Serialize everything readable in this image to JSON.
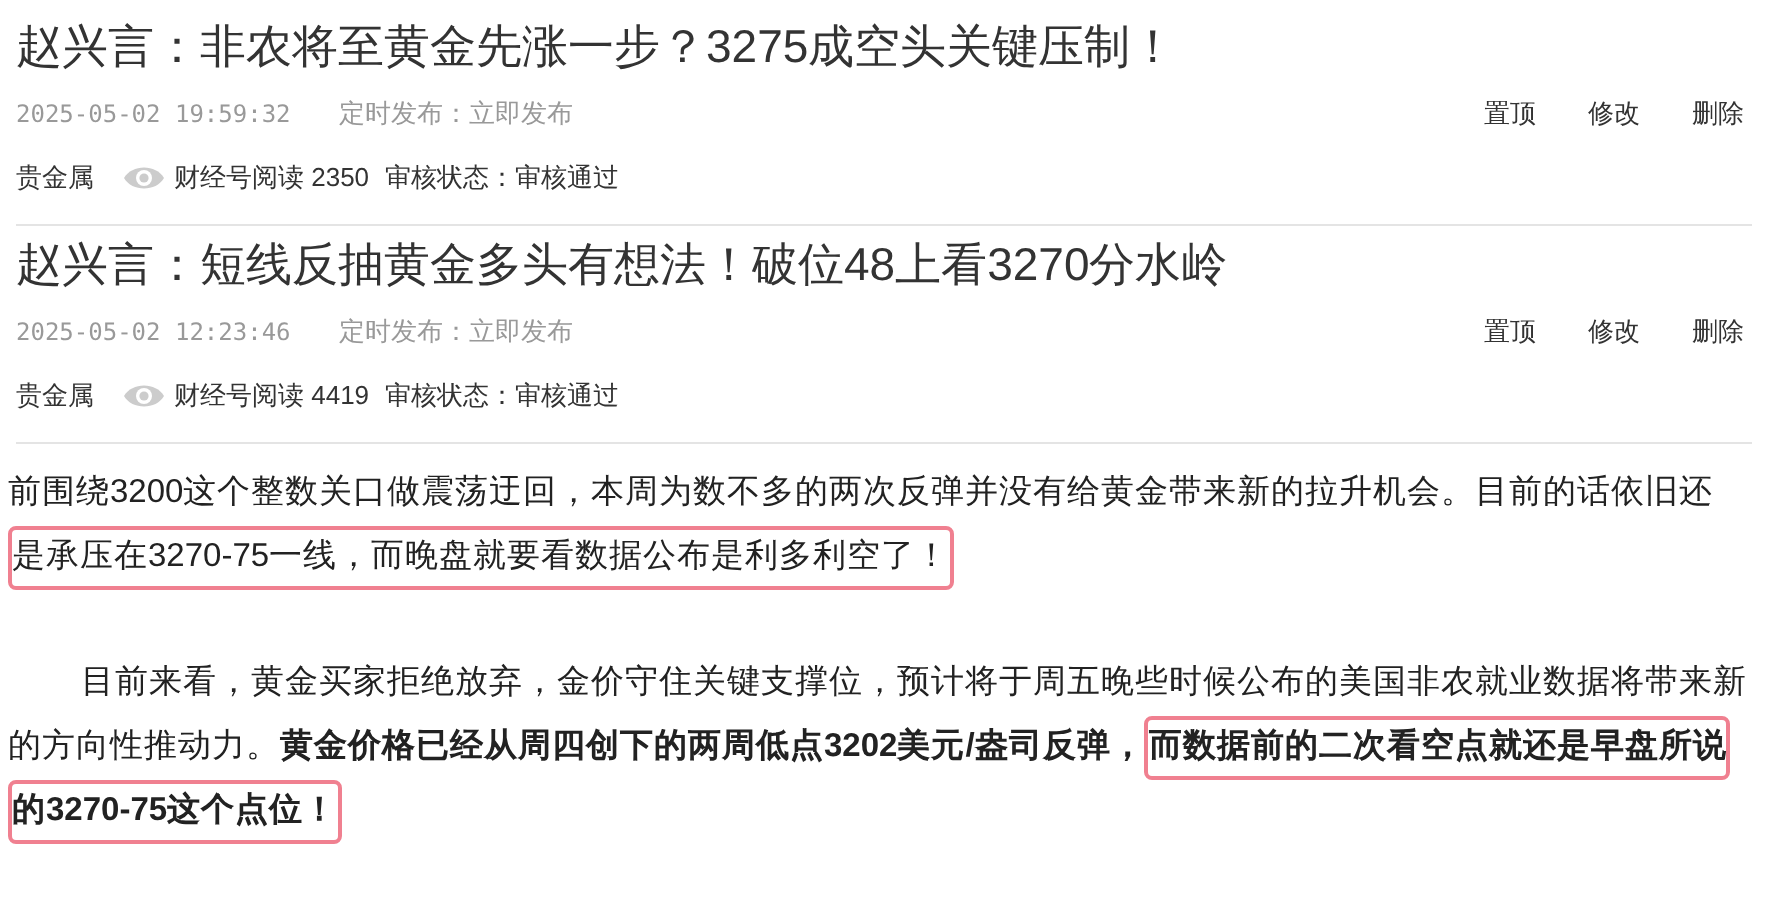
{
  "articles": [
    {
      "title": "赵兴言：非农将至黄金先涨一步？3275成空头关键压制！",
      "time": "2025-05-02 19:59:32",
      "schedule": "定时发布：立即发布",
      "actions": [
        "置顶",
        "修改",
        "删除"
      ],
      "category": "贵金属",
      "reads": "财经号阅读 2350",
      "review": "审核状态：审核通过"
    },
    {
      "title": "赵兴言：短线反抽黄金多头有想法！破位48上看3270分水岭",
      "time": "2025-05-02 12:23:46",
      "schedule": "定时发布：立即发布",
      "actions": [
        "置顶",
        "修改",
        "删除"
      ],
      "category": "贵金属",
      "reads": "财经号阅读 4419",
      "review": "审核状态：审核通过"
    }
  ],
  "body": [
    {
      "indent": false,
      "lines": [
        [
          {
            "text": "前围绕3200这个整数关口做震荡迂回，本周为数不多的两次反弹并没有给黄金带来新的拉升机会。目前的话依旧还",
            "bold": false,
            "highlighted": false
          }
        ],
        [
          {
            "text": "是承压在3270-75一线，而晚盘就要看数据公布是利多利空了！",
            "bold": false,
            "highlighted": true
          }
        ]
      ]
    },
    {
      "indent": true,
      "lines": [
        [
          {
            "text": "目前来看，黄金买家拒绝放弃，金价守住关键支撑位，预计将于周五晚些时候公布的美国非农就业数据将带来新",
            "bold": false,
            "highlighted": false
          }
        ],
        [
          {
            "text": "的方向性推动力。",
            "bold": false,
            "highlighted": false
          },
          {
            "text": "黄金价格已经从周四创下的两周低点3202美元/盎司反弹，",
            "bold": true,
            "highlighted": false
          },
          {
            "text": "而数据前的二次看空点就还是早盘所说",
            "bold": true,
            "highlighted": true
          }
        ],
        [
          {
            "text": "的3270-75这个点位！",
            "bold": true,
            "highlighted": true
          }
        ]
      ]
    }
  ]
}
